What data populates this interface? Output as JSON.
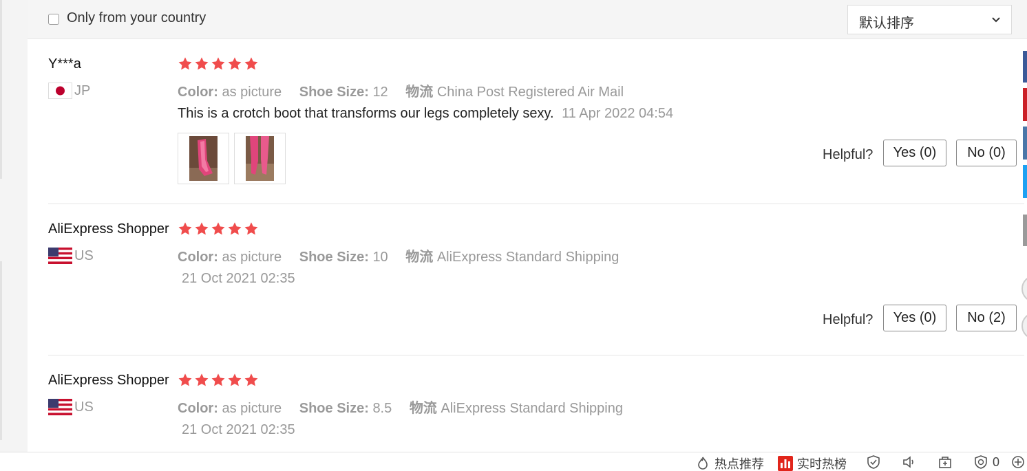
{
  "filter": {
    "only_country_label": "Only from your country",
    "only_country_checked": false
  },
  "sort": {
    "selected": "默认排序"
  },
  "reviews": [
    {
      "name": "Y***a",
      "country": "JP",
      "flag": "japan",
      "rating": 5,
      "color_key": "Color:",
      "color_val": "as picture",
      "size_key": "Shoe Size:",
      "size_val": "12",
      "ship_key": "物流",
      "ship_val": "China Post Registered Air Mail",
      "text": "This is a crotch boot that transforms our legs completely sexy.",
      "date": "11 Apr 2022 04:54",
      "helpful": "Helpful?",
      "yes": "Yes (0)",
      "no": "No (0)"
    },
    {
      "name": "AliExpress Shopper",
      "country": "US",
      "flag": "usa",
      "rating": 5,
      "color_key": "Color:",
      "color_val": "as picture",
      "size_key": "Shoe Size:",
      "size_val": "10",
      "ship_key": "物流",
      "ship_val": "AliExpress Standard Shipping",
      "date": "21 Oct 2021 02:35",
      "helpful": "Helpful?",
      "yes": "Yes (0)",
      "no": "No (2)"
    },
    {
      "name": "AliExpress Shopper",
      "country": "US",
      "flag": "usa",
      "rating": 5,
      "color_key": "Color:",
      "color_val": "as picture",
      "size_key": "Shoe Size:",
      "size_val": "8.5",
      "ship_key": "物流",
      "ship_val": "AliExpress Standard Shipping",
      "date": "21 Oct 2021 02:35"
    }
  ],
  "statusbar": {
    "hot_recommend": "热点推荐",
    "realtime_hot": "实时热榜",
    "ad_count": "0"
  },
  "colors": {
    "star": "#f04c4c",
    "hot_icon": "#e1251b"
  }
}
